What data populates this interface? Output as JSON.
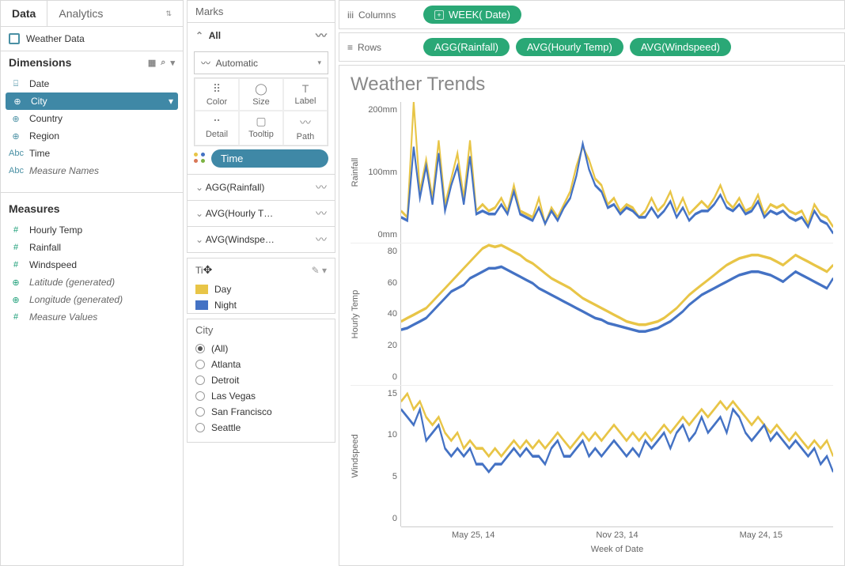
{
  "tabs": {
    "data": "Data",
    "analytics": "Analytics"
  },
  "datasource": "Weather Data",
  "dimensions": {
    "title": "Dimensions",
    "items": [
      {
        "icon": "date",
        "label": "Date"
      },
      {
        "icon": "globe",
        "label": "City",
        "selected": true
      },
      {
        "icon": "globe",
        "label": "Country"
      },
      {
        "icon": "globe",
        "label": "Region"
      },
      {
        "icon": "abc",
        "label": "Time"
      },
      {
        "icon": "abc",
        "label": "Measure Names",
        "italic": true
      }
    ]
  },
  "measures": {
    "title": "Measures",
    "items": [
      {
        "icon": "#",
        "label": "Hourly Temp"
      },
      {
        "icon": "#",
        "label": "Rainfall"
      },
      {
        "icon": "#",
        "label": "Windspeed"
      },
      {
        "icon": "globe",
        "label": "Latitude (generated)",
        "italic": true
      },
      {
        "icon": "globe",
        "label": "Longitude (generated)",
        "italic": true
      },
      {
        "icon": "#",
        "label": "Measure Values",
        "italic": true
      }
    ]
  },
  "marks": {
    "title": "Marks",
    "all": "All",
    "dropdown": "Automatic",
    "cards": [
      "Color",
      "Size",
      "Label",
      "Detail",
      "Tooltip",
      "Path"
    ],
    "time_pill": "Time",
    "agg_rows": [
      "AGG(Rainfall)",
      "AVG(Hourly T…",
      "AVG(Windspe…"
    ]
  },
  "legend": {
    "title_field": "Ti",
    "items": [
      {
        "label": "Day",
        "color": "#e8c547"
      },
      {
        "label": "Night",
        "color": "#4472c4"
      }
    ]
  },
  "filter": {
    "title": "City",
    "options": [
      "(All)",
      "Atlanta",
      "Detroit",
      "Las Vegas",
      "San Francisco",
      "Seattle"
    ],
    "selected": "(All)"
  },
  "shelves": {
    "columns": {
      "label": "Columns",
      "pills": [
        "WEEK( Date)"
      ]
    },
    "rows": {
      "label": "Rows",
      "pills": [
        "AGG(Rainfall)",
        "AVG(Hourly Temp)",
        "AVG(Windspeed)"
      ]
    }
  },
  "viz": {
    "title": "Weather Trends",
    "x_ticks": [
      "May 25, 14",
      "Nov 23, 14",
      "May 24, 15"
    ],
    "x_label": "Week of Date",
    "panels": [
      {
        "label": "Rainfall",
        "ticks": [
          "200mm",
          "100mm",
          "0mm"
        ]
      },
      {
        "label": "Hourly Temp",
        "ticks": [
          "80",
          "60",
          "40",
          "20",
          "0"
        ]
      },
      {
        "label": "Windspeed",
        "ticks": [
          "15",
          "10",
          "5",
          "0"
        ]
      }
    ]
  },
  "chart_data": [
    {
      "type": "line",
      "title": "Rainfall",
      "ylabel": "Rainfall",
      "ylim": [
        0,
        220
      ],
      "y_unit": "mm",
      "x": [
        0,
        1,
        2,
        3,
        4,
        5,
        6,
        7,
        8,
        9,
        10,
        11,
        12,
        13,
        14,
        15,
        16,
        17,
        18,
        19,
        20,
        21,
        22,
        23,
        24,
        25,
        26,
        27,
        28,
        29,
        30,
        31,
        32,
        33,
        34,
        35,
        36,
        37,
        38,
        39,
        40,
        41,
        42,
        43,
        44,
        45,
        46,
        47,
        48,
        49,
        50,
        51,
        52,
        53,
        54,
        55,
        56,
        57,
        58,
        59,
        60,
        61,
        62,
        63,
        64,
        65,
        66,
        67,
        68,
        69
      ],
      "series": [
        {
          "name": "Day",
          "color": "#e8c547",
          "values": [
            50,
            40,
            220,
            80,
            130,
            70,
            160,
            60,
            100,
            140,
            70,
            160,
            50,
            60,
            50,
            55,
            70,
            50,
            90,
            50,
            45,
            40,
            70,
            30,
            55,
            40,
            60,
            80,
            120,
            150,
            130,
            100,
            90,
            60,
            70,
            50,
            60,
            55,
            40,
            50,
            70,
            50,
            60,
            80,
            50,
            70,
            45,
            55,
            65,
            55,
            70,
            90,
            65,
            55,
            70,
            50,
            55,
            75,
            45,
            60,
            55,
            60,
            50,
            45,
            50,
            30,
            60,
            45,
            40,
            25
          ]
        },
        {
          "name": "Night",
          "color": "#4472c4",
          "values": [
            40,
            35,
            150,
            70,
            120,
            60,
            140,
            50,
            90,
            120,
            60,
            135,
            45,
            50,
            45,
            45,
            60,
            45,
            80,
            45,
            40,
            35,
            55,
            30,
            50,
            35,
            55,
            70,
            105,
            155,
            115,
            90,
            80,
            55,
            60,
            45,
            55,
            50,
            40,
            40,
            55,
            40,
            50,
            65,
            40,
            55,
            35,
            45,
            50,
            50,
            60,
            75,
            55,
            50,
            60,
            45,
            50,
            65,
            40,
            50,
            45,
            50,
            40,
            35,
            40,
            25,
            50,
            35,
            30,
            15
          ]
        }
      ]
    },
    {
      "type": "line",
      "title": "Hourly Temp",
      "ylabel": "Hourly Temp",
      "ylim": [
        0,
        85
      ],
      "x": [
        0,
        1,
        2,
        3,
        4,
        5,
        6,
        7,
        8,
        9,
        10,
        11,
        12,
        13,
        14,
        15,
        16,
        17,
        18,
        19,
        20,
        21,
        22,
        23,
        24,
        25,
        26,
        27,
        28,
        29,
        30,
        31,
        32,
        33,
        34,
        35,
        36,
        37,
        38,
        39,
        40,
        41,
        42,
        43,
        44,
        45,
        46,
        47,
        48,
        49,
        50,
        51,
        52,
        53,
        54,
        55,
        56,
        57,
        58,
        59,
        60,
        61,
        62,
        63,
        64,
        65,
        66,
        67,
        68,
        69
      ],
      "series": [
        {
          "name": "Day",
          "color": "#e8c547",
          "values": [
            38,
            40,
            42,
            44,
            46,
            50,
            54,
            58,
            62,
            66,
            70,
            74,
            78,
            82,
            84,
            83,
            84,
            82,
            80,
            78,
            75,
            73,
            70,
            67,
            64,
            62,
            60,
            58,
            55,
            52,
            50,
            48,
            46,
            44,
            42,
            40,
            38,
            37,
            36,
            36,
            37,
            38,
            40,
            43,
            46,
            50,
            54,
            57,
            60,
            63,
            66,
            69,
            72,
            74,
            76,
            77,
            78,
            78,
            77,
            76,
            74,
            72,
            75,
            78,
            76,
            74,
            72,
            70,
            68,
            72
          ]
        },
        {
          "name": "Night",
          "color": "#4472c4",
          "values": [
            33,
            34,
            36,
            38,
            40,
            44,
            48,
            52,
            56,
            58,
            60,
            64,
            66,
            68,
            70,
            70,
            71,
            69,
            67,
            65,
            63,
            61,
            58,
            56,
            54,
            52,
            50,
            48,
            46,
            44,
            42,
            40,
            39,
            37,
            36,
            35,
            34,
            33,
            32,
            32,
            33,
            34,
            36,
            38,
            41,
            44,
            48,
            51,
            54,
            56,
            58,
            60,
            62,
            64,
            66,
            67,
            68,
            68,
            67,
            66,
            64,
            62,
            65,
            68,
            66,
            64,
            62,
            60,
            58,
            64
          ]
        }
      ]
    },
    {
      "type": "line",
      "title": "Windspeed",
      "ylabel": "Windspeed",
      "ylim": [
        0,
        18
      ],
      "x": [
        0,
        1,
        2,
        3,
        4,
        5,
        6,
        7,
        8,
        9,
        10,
        11,
        12,
        13,
        14,
        15,
        16,
        17,
        18,
        19,
        20,
        21,
        22,
        23,
        24,
        25,
        26,
        27,
        28,
        29,
        30,
        31,
        32,
        33,
        34,
        35,
        36,
        37,
        38,
        39,
        40,
        41,
        42,
        43,
        44,
        45,
        46,
        47,
        48,
        49,
        50,
        51,
        52,
        53,
        54,
        55,
        56,
        57,
        58,
        59,
        60,
        61,
        62,
        63,
        64,
        65,
        66,
        67,
        68,
        69
      ],
      "series": [
        {
          "name": "Day",
          "color": "#e8c547",
          "values": [
            16,
            17,
            15,
            16,
            14,
            13,
            14,
            12,
            11,
            12,
            10,
            11,
            10,
            10,
            9,
            10,
            9,
            10,
            11,
            10,
            11,
            10,
            11,
            10,
            11,
            12,
            11,
            10,
            11,
            12,
            11,
            12,
            11,
            12,
            13,
            12,
            11,
            12,
            11,
            12,
            11,
            12,
            13,
            12,
            13,
            14,
            13,
            14,
            15,
            14,
            15,
            16,
            15,
            16,
            15,
            14,
            13,
            14,
            13,
            12,
            13,
            12,
            11,
            12,
            11,
            10,
            11,
            10,
            11,
            9
          ]
        },
        {
          "name": "Night",
          "color": "#4472c4",
          "values": [
            15,
            14,
            13,
            15,
            11,
            12,
            13,
            10,
            9,
            10,
            9,
            10,
            8,
            8,
            7,
            8,
            8,
            9,
            10,
            9,
            10,
            9,
            9,
            8,
            10,
            11,
            9,
            9,
            10,
            11,
            9,
            10,
            9,
            10,
            11,
            10,
            9,
            10,
            9,
            11,
            10,
            11,
            12,
            10,
            12,
            13,
            11,
            12,
            14,
            12,
            13,
            14,
            12,
            15,
            14,
            12,
            11,
            12,
            13,
            11,
            12,
            11,
            10,
            11,
            10,
            9,
            10,
            8,
            9,
            7
          ]
        }
      ]
    }
  ]
}
